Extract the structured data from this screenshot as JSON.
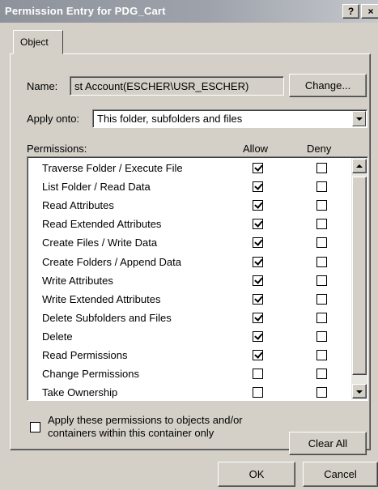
{
  "window": {
    "title": "Permission Entry for PDG_Cart",
    "help_glyph": "?",
    "close_glyph": "×"
  },
  "tabs": [
    {
      "label": "Object",
      "selected": true
    }
  ],
  "name_row": {
    "label": "Name:",
    "value": "st Account(ESCHER\\USR_ESCHER)",
    "change_button": "Change..."
  },
  "apply_onto": {
    "label": "Apply onto:",
    "selected": "This folder, subfolders and files"
  },
  "permissions": {
    "header_label": "Permissions:",
    "allow_header": "Allow",
    "deny_header": "Deny",
    "rows": [
      {
        "name": "Traverse Folder / Execute File",
        "allow": true,
        "deny": false
      },
      {
        "name": "List Folder / Read Data",
        "allow": true,
        "deny": false
      },
      {
        "name": "Read Attributes",
        "allow": true,
        "deny": false
      },
      {
        "name": "Read Extended Attributes",
        "allow": true,
        "deny": false
      },
      {
        "name": "Create Files / Write Data",
        "allow": true,
        "deny": false
      },
      {
        "name": "Create Folders / Append Data",
        "allow": true,
        "deny": false
      },
      {
        "name": "Write Attributes",
        "allow": true,
        "deny": false
      },
      {
        "name": "Write Extended Attributes",
        "allow": true,
        "deny": false
      },
      {
        "name": "Delete Subfolders and Files",
        "allow": true,
        "deny": false
      },
      {
        "name": "Delete",
        "allow": true,
        "deny": false
      },
      {
        "name": "Read Permissions",
        "allow": true,
        "deny": false
      },
      {
        "name": "Change Permissions",
        "allow": false,
        "deny": false
      },
      {
        "name": "Take Ownership",
        "allow": false,
        "deny": false
      }
    ]
  },
  "apply_checkbox": {
    "checked": false,
    "label": "Apply these permissions to objects and/or containers within this container only"
  },
  "buttons": {
    "clear_all": "Clear All",
    "ok": "OK",
    "cancel": "Cancel"
  }
}
